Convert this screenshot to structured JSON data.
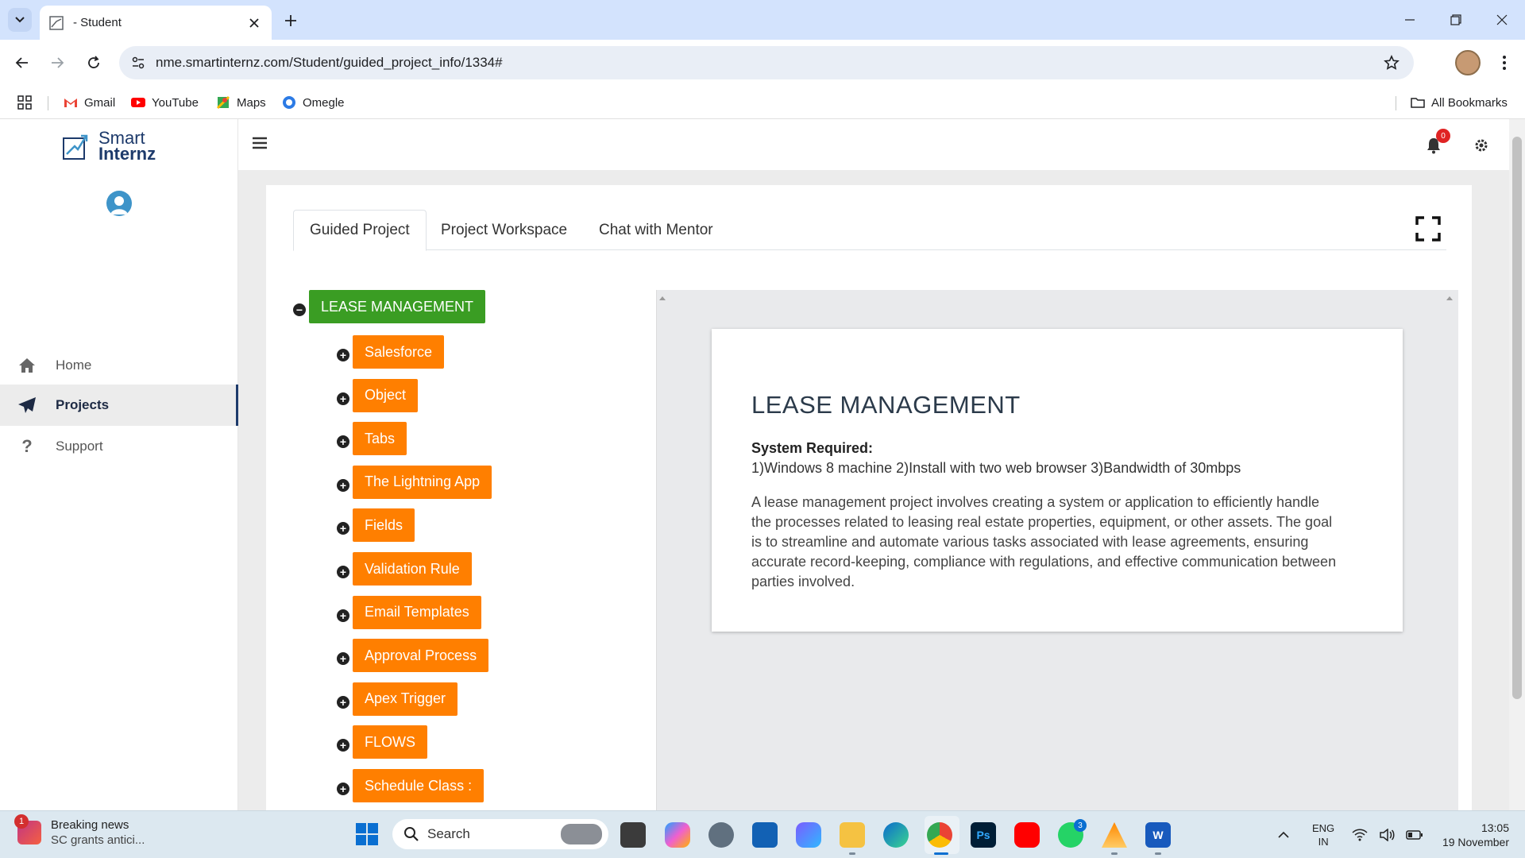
{
  "browser": {
    "tab_title": "- Student",
    "url": "nme.smartinternz.com/Student/guided_project_info/1334#",
    "bookmarks": [
      {
        "label": "Gmail",
        "icon": "gmail-icon"
      },
      {
        "label": "YouTube",
        "icon": "youtube-icon"
      },
      {
        "label": "Maps",
        "icon": "maps-icon"
      },
      {
        "label": "Omegle",
        "icon": "omegle-icon"
      }
    ],
    "all_bookmarks": "All Bookmarks"
  },
  "brand": {
    "line1": "Smart",
    "line2": "Internz"
  },
  "sidebar": {
    "items": [
      {
        "label": "Home",
        "icon": "home-icon"
      },
      {
        "label": "Projects",
        "icon": "paper-plane-icon"
      },
      {
        "label": "Support",
        "icon": "question-icon"
      }
    ]
  },
  "topbar": {
    "notification_count": "0"
  },
  "tabs": [
    "Guided Project",
    "Project Workspace",
    "Chat with Mentor"
  ],
  "tree": {
    "root": "LEASE MANAGEMENT",
    "children": [
      "Salesforce",
      "Object",
      "Tabs",
      "The Lightning App",
      "Fields",
      "Validation Rule",
      "Email Templates",
      "Approval Process",
      "Apex Trigger",
      "FLOWS",
      "Schedule Class :"
    ]
  },
  "detail": {
    "title": "LEASE MANAGEMENT",
    "system_label": "System Required:",
    "requirements": "1)Windows 8 machine 2)Install with two web browser 3)Bandwidth of 30mbps",
    "description": "A lease management project involves creating a system or application to efficiently handle the processes related to leasing real estate properties, equipment, or other assets. The goal is to streamline and automate various tasks associated with lease agreements, ensuring accurate record-keeping, compliance with regulations, and effective communication between parties involved."
  },
  "taskbar": {
    "news_title": "Breaking news",
    "news_sub": "SC grants antici...",
    "news_badge": "1",
    "search_placeholder": "Search",
    "whatsapp_badge": "3",
    "lang1": "ENG",
    "lang2": "IN",
    "time": "13:05",
    "date": "19 November"
  },
  "colors": {
    "green": "#3a9d23",
    "orange": "#ff7f00",
    "brand": "#1d3a6b",
    "badge": "#e02424"
  }
}
